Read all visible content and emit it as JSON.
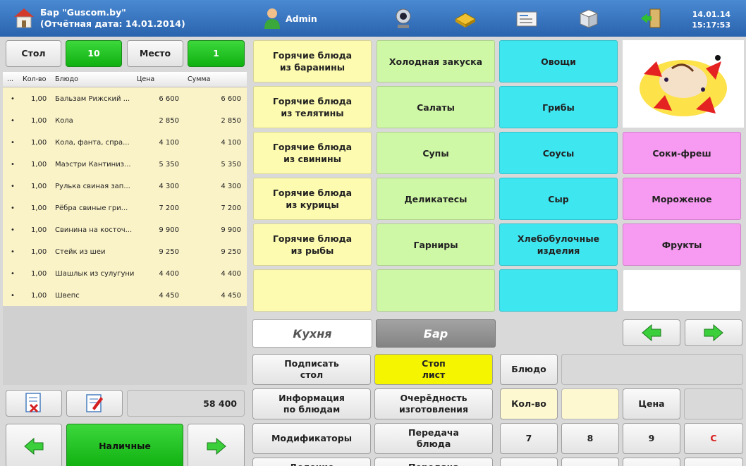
{
  "header": {
    "title_line1": "Бар \"Guscom.by\"",
    "title_line2": "(Отчётная дата: 14.01.2014)",
    "user": "Admin",
    "date": "14.01.14",
    "time": "15:17:53"
  },
  "table_controls": {
    "table_label": "Стол",
    "table_value": "10",
    "seat_label": "Место",
    "seat_value": "1"
  },
  "order": {
    "columns": [
      "...",
      "Кол-во",
      "Блюдо",
      "Цена",
      "Сумма"
    ],
    "rows": [
      {
        "dot": "•",
        "qty": "1,00",
        "name": "Бальзам Рижский ...",
        "price": "6 600",
        "sum": "6 600"
      },
      {
        "dot": "•",
        "qty": "1,00",
        "name": "Кола",
        "price": "2 850",
        "sum": "2 850"
      },
      {
        "dot": "•",
        "qty": "1,00",
        "name": "Кола, фанта, спра...",
        "price": "4 100",
        "sum": "4 100"
      },
      {
        "dot": "•",
        "qty": "1,00",
        "name": "Маэстри Кантиниз...",
        "price": "5 350",
        "sum": "5 350"
      },
      {
        "dot": "•",
        "qty": "1,00",
        "name": "Рулька свиная зап...",
        "price": "4 300",
        "sum": "4 300"
      },
      {
        "dot": "•",
        "qty": "1,00",
        "name": "Рёбра свиные гри...",
        "price": "7 200",
        "sum": "7 200"
      },
      {
        "dot": "•",
        "qty": "1,00",
        "name": "Свинина на косточ...",
        "price": "9 900",
        "sum": "9 900"
      },
      {
        "dot": "•",
        "qty": "1,00",
        "name": "Стейк из шеи",
        "price": "9 250",
        "sum": "9 250"
      },
      {
        "dot": "•",
        "qty": "1,00",
        "name": "Шашлык из сулугуни",
        "price": "4 400",
        "sum": "4 400"
      },
      {
        "dot": "•",
        "qty": "1,00",
        "name": "Швепс",
        "price": "4 450",
        "sum": "4 450"
      }
    ],
    "total": "58 400"
  },
  "payment": {
    "cash_label": "Наличные"
  },
  "categories": {
    "col1": [
      "Горячие блюда\nиз баранины",
      "Горячие блюда\nиз телятины",
      "Горячие блюда\nиз свинины",
      "Горячие блюда\nиз курицы",
      "Горячие блюда\nиз рыбы",
      ""
    ],
    "col2": [
      "Холодная закуска",
      "Салаты",
      "Супы",
      "Деликатесы",
      "Гарниры",
      ""
    ],
    "col3": [
      "Овощи",
      "Грибы",
      "Соусы",
      "Сыр",
      "Хлебобулочные\nизделия",
      ""
    ],
    "col4": [
      "Соки-фреш",
      "Мороженое",
      "Фрукты",
      ""
    ]
  },
  "tabs": {
    "kitchen": "Кухня",
    "bar": "Бар"
  },
  "actions": {
    "sign_table": "Подписать\nстол",
    "stop_list": "Стоп\nлист",
    "dish_info": "Информация\nпо блюдам",
    "queue": "Очерёдность\nизготовления",
    "modifiers": "Модификаторы",
    "transfer_dish": "Передача\nблюда",
    "split": "Деление",
    "transfer": "Передача"
  },
  "keypad": {
    "dish_label": "Блюдо",
    "qty_label": "Кол-во",
    "price_label": "Цена",
    "keys": [
      "7",
      "8",
      "9",
      "C"
    ]
  },
  "colors": {
    "header": "#2f6cb8",
    "yellow_tile": "#fdfbb0",
    "green_tile": "#cef7a6",
    "cyan_tile": "#3ee6f0",
    "pink_tile": "#f79af1",
    "green_button": "#21c421",
    "stop_list": "#f5f500"
  }
}
